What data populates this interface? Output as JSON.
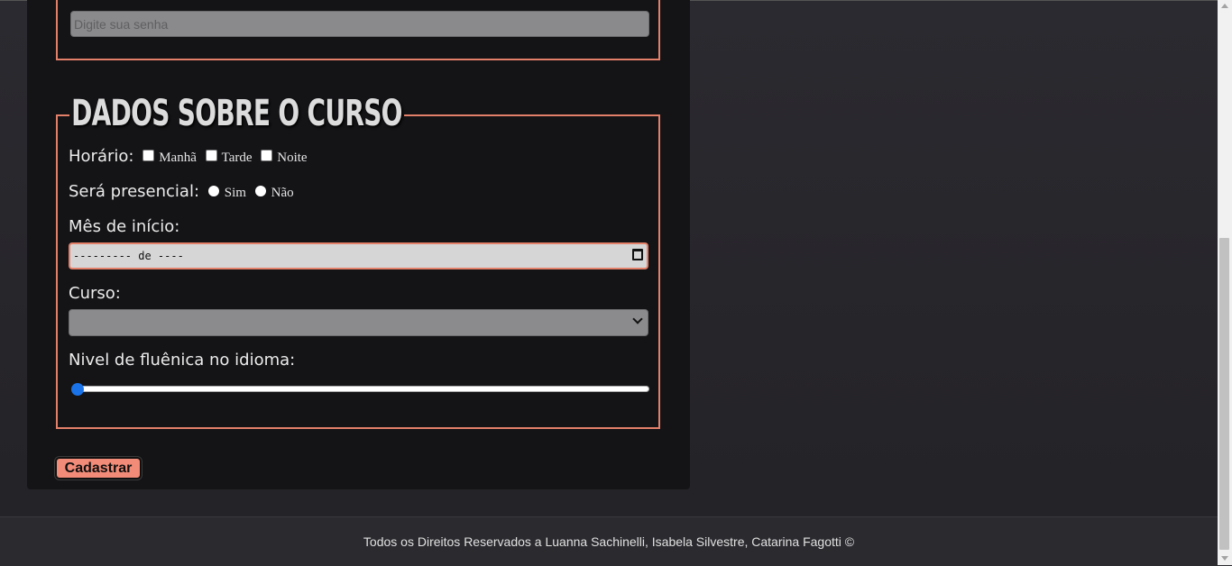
{
  "form": {
    "password_placeholder": "Digite sua senha",
    "section_title": "DADOS SOBRE O CURSO",
    "horario_label": "Horário:",
    "horario_options": [
      "Manhã",
      "Tarde",
      "Noite"
    ],
    "presencial_label": "Será presencial:",
    "presencial_options": [
      "Sim",
      "Não"
    ],
    "mes_label": "Mês de início:",
    "mes_value": "--------- de ----",
    "curso_label": "Curso:",
    "curso_value": "",
    "fluencia_label": "Nivel de fluênica no idioma:",
    "fluencia_level": 0,
    "submit_label": "Cadastrar"
  },
  "footer": {
    "text": "Todos os Direitos Reservados a Luanna Sachinelli, Isabela Silvestre, Catarina Fagotti ©"
  },
  "colors": {
    "accent": "#e3806a",
    "button": "#f28b77",
    "slider_thumb": "#1a73e8"
  }
}
